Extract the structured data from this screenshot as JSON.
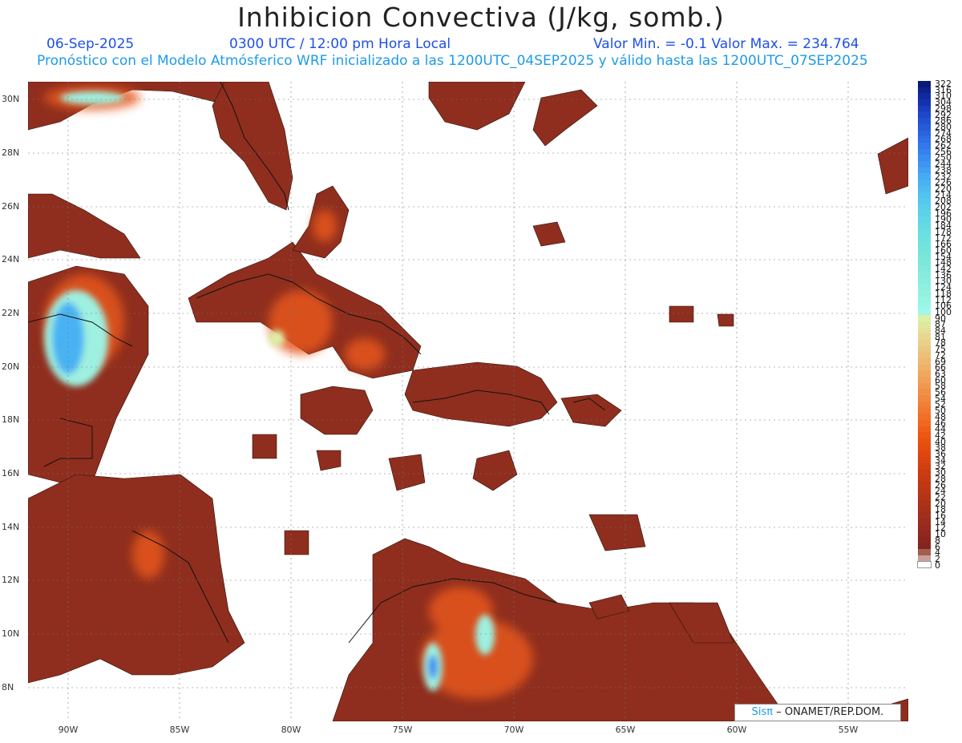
{
  "title": "Inhibicion Convectiva (J/kg, somb.)",
  "header": {
    "date": "06-Sep-2025",
    "time": "0300 UTC / 12:00 pm Hora Local",
    "minmax": "Valor Min. = -0.1  Valor Max. = 234.764",
    "model_line": "Pronóstico con el Modelo Atmósferico WRF inicializado a las 1200UTC_04SEP2025 y válido hasta las  1200UTC_07SEP2025"
  },
  "lat_labels": [
    "30N",
    "28N",
    "26N",
    "24N",
    "22N",
    "20N",
    "18N",
    "16N",
    "14N",
    "12N",
    "10N",
    "8N"
  ],
  "lon_labels": [
    "90W",
    "85W",
    "80W",
    "75W",
    "70W",
    "65W",
    "60W",
    "55W"
  ],
  "colorbar": {
    "labels": [
      "322",
      "316",
      "310",
      "304",
      "298",
      "292",
      "286",
      "280",
      "274",
      "268",
      "262",
      "256",
      "250",
      "244",
      "238",
      "232",
      "226",
      "220",
      "214",
      "208",
      "202",
      "196",
      "190",
      "184",
      "178",
      "172",
      "166",
      "160",
      "154",
      "148",
      "142",
      "136",
      "130",
      "124",
      "118",
      "112",
      "106",
      "100",
      "90",
      "87",
      "84",
      "81",
      "78",
      "75",
      "72",
      "69",
      "66",
      "63",
      "60",
      "58",
      "56",
      "54",
      "52",
      "50",
      "48",
      "46",
      "44",
      "42",
      "40",
      "38",
      "36",
      "34",
      "32",
      "30",
      "28",
      "26",
      "24",
      "22",
      "20",
      "18",
      "16",
      "14",
      "12",
      "10",
      "8",
      "6",
      "4",
      "2",
      "0"
    ],
    "colors": [
      "#0a1a78",
      "#0e228c",
      "#122aa0",
      "#1432b0",
      "#1a3cbe",
      "#1e46c8",
      "#2250d0",
      "#265ad8",
      "#2a64e0",
      "#2e6ee6",
      "#3278ea",
      "#3682ee",
      "#3a8cf0",
      "#3e96f2",
      "#42a0f4",
      "#46aaf4",
      "#4ab2f2",
      "#4ebaf0",
      "#52c2ee",
      "#56c8ec",
      "#5aceea",
      "#5ed2e8",
      "#62d6e6",
      "#66dae4",
      "#6adee2",
      "#6ee0e0",
      "#72e2de",
      "#76e4dc",
      "#7ae6da",
      "#7ee8d8",
      "#82eada",
      "#86ecdc",
      "#8aeede",
      "#8ef0e0",
      "#92f2e2",
      "#96f4e4",
      "#9af6e6",
      "#a0f8e8",
      "#dcf0a8",
      "#e0e8a0",
      "#e4e098",
      "#e6d890",
      "#e8d088",
      "#eac880",
      "#ecc078",
      "#eeb870",
      "#f0b068",
      "#f0a860",
      "#f0a058",
      "#f09850",
      "#f09048",
      "#f08840",
      "#f08038",
      "#f07830",
      "#f07028",
      "#f06820",
      "#ee6018",
      "#ec5814",
      "#e85010",
      "#e44c10",
      "#de4810",
      "#d84410",
      "#d24010",
      "#cc3c10",
      "#c63a12",
      "#c03812",
      "#ba3614",
      "#b43416",
      "#ae3218",
      "#a8301a",
      "#a22e1c",
      "#9c2c1e",
      "#962a20",
      "#902820",
      "#8a2620",
      "#842420",
      "#a06050",
      "#c8a098",
      "#ffffff"
    ]
  },
  "credit": {
    "sis": "Sisπ",
    "org": "– ONAMET/REP.DOM."
  }
}
